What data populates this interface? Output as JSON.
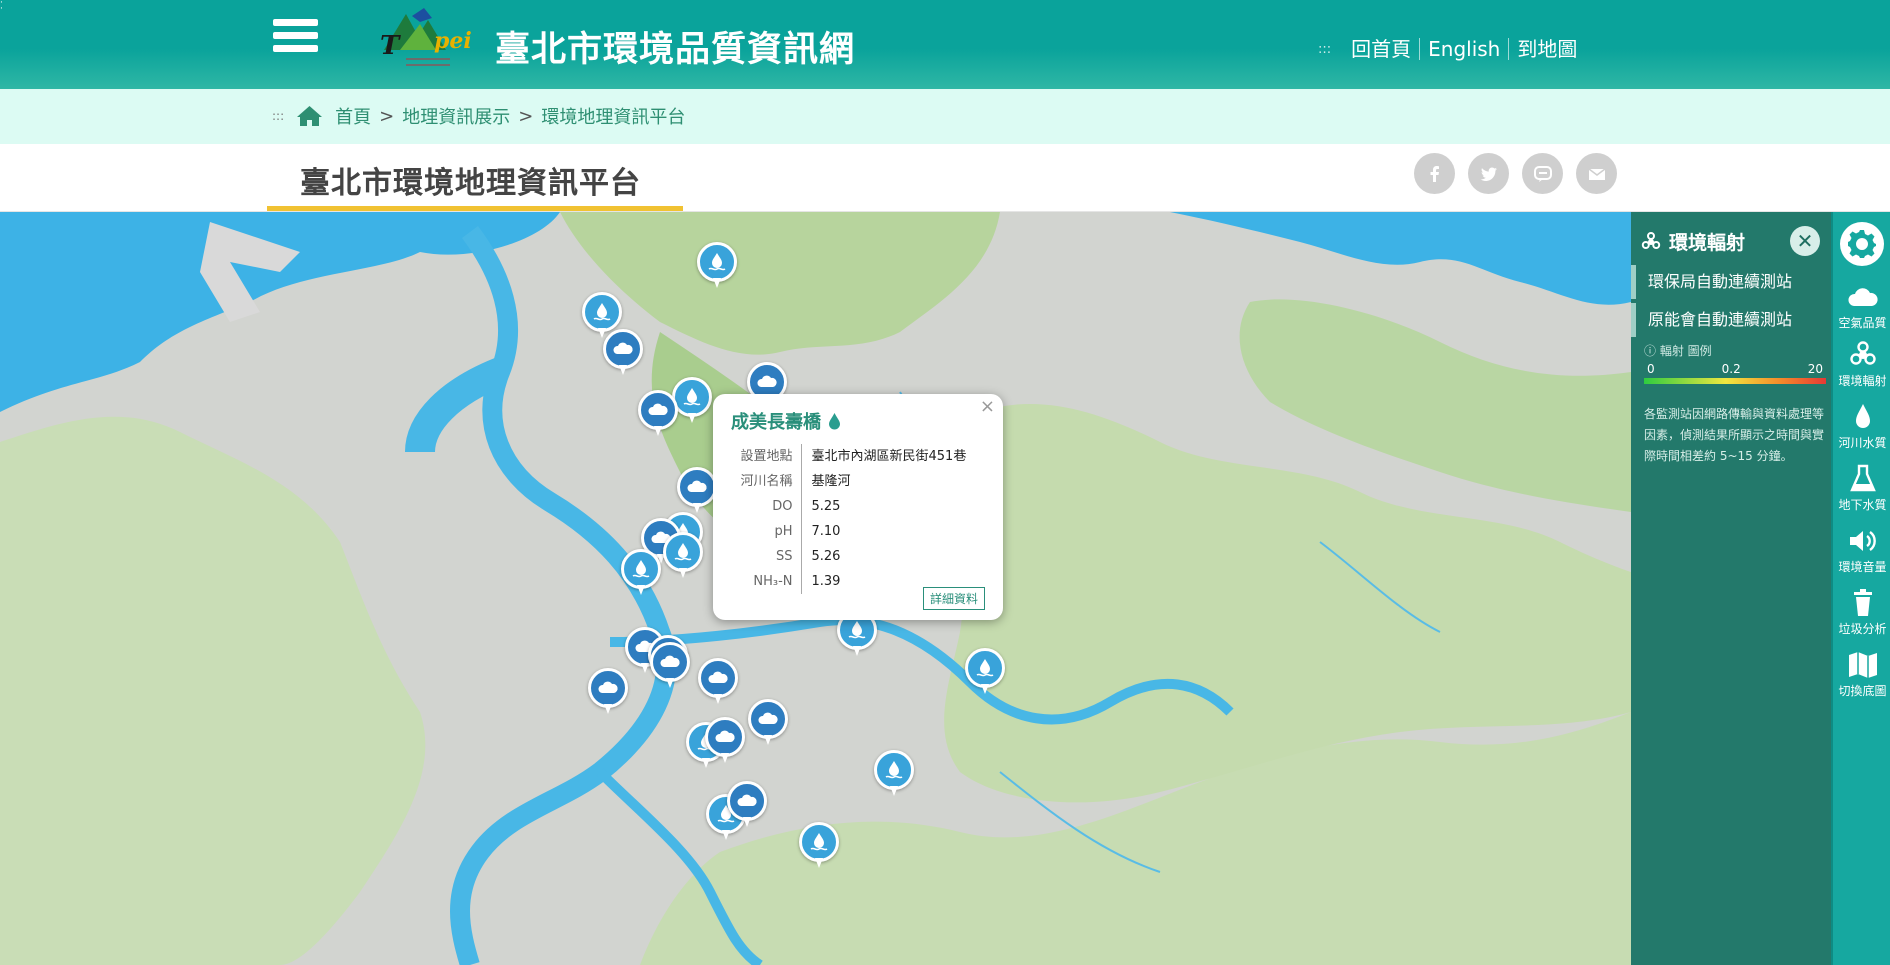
{
  "header": {
    "site_title": "臺北市環境品質資訊網",
    "links": [
      "回首頁",
      "English",
      "到地圖"
    ],
    "dots": ":::"
  },
  "breadcrumb": {
    "dots": ":::",
    "items": [
      "首頁",
      "地理資訊展示",
      "環境地理資訊平台"
    ],
    "separator": ">"
  },
  "page": {
    "title": "臺北市環境地理資訊平台"
  },
  "share": [
    "facebook-icon",
    "twitter-icon",
    "line-icon",
    "email-icon"
  ],
  "popup": {
    "title": "成美長壽橋",
    "rows": [
      {
        "key": "設置地點",
        "value": "臺北市內湖區新民街451巷"
      },
      {
        "key": "河川名稱",
        "value": "基隆河"
      },
      {
        "key": "DO",
        "value": "5.25"
      },
      {
        "key": "pH",
        "value": "7.10"
      },
      {
        "key": "SS",
        "value": "5.26"
      },
      {
        "key": "NH₃-N",
        "value": "1.39"
      }
    ],
    "more_label": "詳細資料",
    "close_label": "×"
  },
  "panel": {
    "title": "環境輻射",
    "close_label": "✕",
    "items": [
      "環保局自動連續測站",
      "原能會自動連續測站"
    ],
    "legend_title": "輻射 圖例",
    "scale_labels": [
      "0",
      "0.2",
      "20"
    ],
    "note": "各監測站因網路傳輸與資料處理等因素，偵測結果所顯示之時間與實際時間相差約 5~15 分鐘。"
  },
  "rail": {
    "buttons": [
      "空氣品質",
      "環境輻射",
      "河川水質",
      "地下水質",
      "環境音量",
      "垃圾分析",
      "切換底圖"
    ]
  },
  "colors": {
    "header": "#0aa39b",
    "panel": "#23796b",
    "rail": "#16a8a0",
    "water_marker": "#39a3da",
    "air_marker": "#2e7dc0",
    "sea": "#3db2e6",
    "land": "#d2d4d0",
    "green": "#b9d6a4",
    "underline": "#f1c232"
  }
}
